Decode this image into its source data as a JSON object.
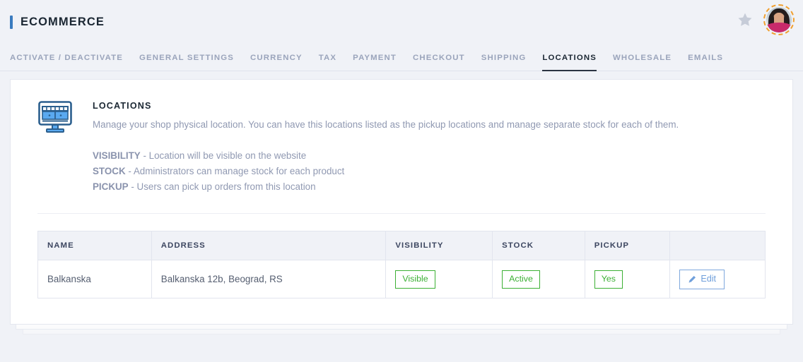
{
  "header": {
    "app_title": "ECOMMERCE",
    "star_icon": "star-icon",
    "avatar_icon": "user-avatar",
    "accent_color": "#3a7bbf"
  },
  "nav": {
    "items": [
      {
        "label": "ACTIVATE / DEACTIVATE",
        "active": false
      },
      {
        "label": "GENERAL SETTINGS",
        "active": false
      },
      {
        "label": "CURRENCY",
        "active": false
      },
      {
        "label": "TAX",
        "active": false
      },
      {
        "label": "PAYMENT",
        "active": false
      },
      {
        "label": "CHECKOUT",
        "active": false
      },
      {
        "label": "SHIPPING",
        "active": false
      },
      {
        "label": "LOCATIONS",
        "active": true
      },
      {
        "label": "WHOLESALE",
        "active": false
      },
      {
        "label": "EMAILS",
        "active": false
      }
    ]
  },
  "section": {
    "icon": "shop-storefront-icon",
    "title": "LOCATIONS",
    "description": "Manage your shop physical location. You can have this locations listed as the pickup locations and manage separate stock for each of them.",
    "legend": [
      {
        "key": "VISIBILITY",
        "text": "- Location will be visible on the website"
      },
      {
        "key": "STOCK",
        "text": "- Administrators can manage stock for each product"
      },
      {
        "key": "PICKUP",
        "text": "- Users can pick up orders from this location"
      }
    ]
  },
  "table": {
    "columns": [
      "NAME",
      "ADDRESS",
      "VISIBILITY",
      "STOCK",
      "PICKUP",
      ""
    ],
    "rows": [
      {
        "name": "Balkanska",
        "address": "Balkanska 12b, Beograd, RS",
        "visibility": "Visible",
        "stock": "Active",
        "pickup": "Yes",
        "action_label": "Edit",
        "action_icon": "pencil-icon"
      }
    ],
    "badge_color": "#3cb034",
    "action_color": "#6f9fdb"
  }
}
